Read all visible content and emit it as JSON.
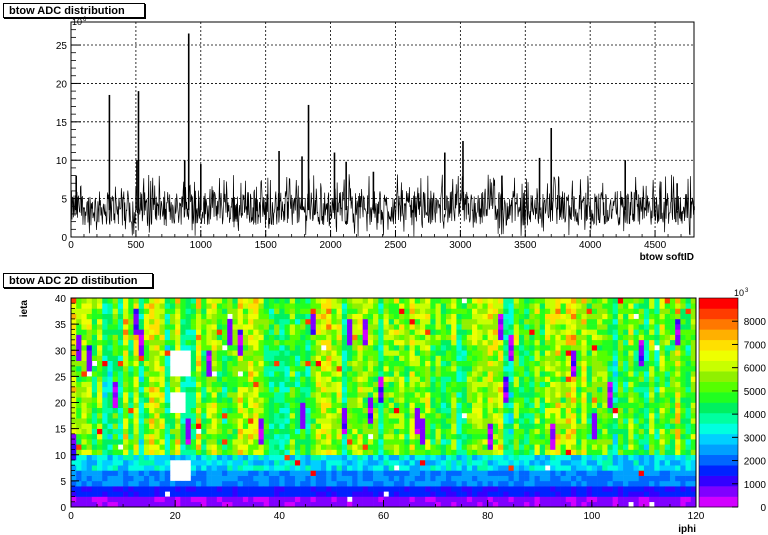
{
  "chart_data": [
    {
      "type": "histogram",
      "title": "btow ADC distribution",
      "xlabel": "btow softID",
      "ylabel": "",
      "xlim": [
        0,
        4800
      ],
      "ylim": [
        0,
        28
      ],
      "y_multiplier_label": "10",
      "y_multiplier_exp": "6",
      "x_ticks": [
        "0",
        "500",
        "1000",
        "1500",
        "2000",
        "2500",
        "3000",
        "3500",
        "4000",
        "4500"
      ],
      "y_ticks": [
        "0",
        "5",
        "10",
        "15",
        "20",
        "25"
      ],
      "grid": true,
      "baseline_band": [
        1.5,
        6.0
      ],
      "series_color": "#000000",
      "spikes": [
        {
          "x": 296,
          "y": 18.5
        },
        {
          "x": 520,
          "y": 19.0
        },
        {
          "x": 508,
          "y": 10.0
        },
        {
          "x": 907,
          "y": 26.5
        },
        {
          "x": 876,
          "y": 10.0
        },
        {
          "x": 1000,
          "y": 9.5
        },
        {
          "x": 1603,
          "y": 11.2
        },
        {
          "x": 1830,
          "y": 17.2
        },
        {
          "x": 1780,
          "y": 10.5
        },
        {
          "x": 2030,
          "y": 11.0
        },
        {
          "x": 2120,
          "y": 9.8
        },
        {
          "x": 2330,
          "y": 8.5
        },
        {
          "x": 2880,
          "y": 11.0
        },
        {
          "x": 3020,
          "y": 12.5
        },
        {
          "x": 3320,
          "y": 8.0
        },
        {
          "x": 3610,
          "y": 10.3
        },
        {
          "x": 3700,
          "y": 14.2
        },
        {
          "x": 4270,
          "y": 10.0
        },
        {
          "x": 4800,
          "y": 4.0
        },
        {
          "x": 4670,
          "y": 7.0
        },
        {
          "x": 40,
          "y": 8.0
        }
      ]
    },
    {
      "type": "heatmap",
      "title": "btow ADC 2D distibution",
      "xlabel": "iphi",
      "ylabel": "ieta",
      "xlim": [
        0,
        120
      ],
      "ylim": [
        0,
        40
      ],
      "x_ticks": [
        "0",
        "20",
        "40",
        "60",
        "80",
        "100",
        "120"
      ],
      "y_ticks": [
        "0",
        "5",
        "10",
        "15",
        "20",
        "25",
        "30",
        "35",
        "40"
      ],
      "z_range": [
        0,
        9000
      ],
      "z_multiplier_label": "10",
      "z_multiplier_exp": "3",
      "z_ticks": [
        "0",
        "1000",
        "2000",
        "3000",
        "4000",
        "5000",
        "6000",
        "7000",
        "8000"
      ],
      "palette": [
        "#d200ff",
        "#8000ff",
        "#3300ff",
        "#0022ff",
        "#0066ff",
        "#00a0ff",
        "#00d0ff",
        "#00ffe0",
        "#00ffa0",
        "#00f060",
        "#20ff20",
        "#55ff00",
        "#90f000",
        "#c8ff00",
        "#eeff00",
        "#ffe000",
        "#ffb000",
        "#ff7800",
        "#ff3c00",
        "#ff0000"
      ],
      "blank_cells_note": "",
      "blank_regions": [
        {
          "iphi": [
            19,
            23
          ],
          "ieta": [
            5,
            9
          ]
        },
        {
          "iphi": [
            19,
            23
          ],
          "ieta": [
            25,
            30
          ]
        },
        {
          "iphi": [
            19,
            22
          ],
          "ieta": [
            18,
            22
          ]
        }
      ]
    }
  ]
}
